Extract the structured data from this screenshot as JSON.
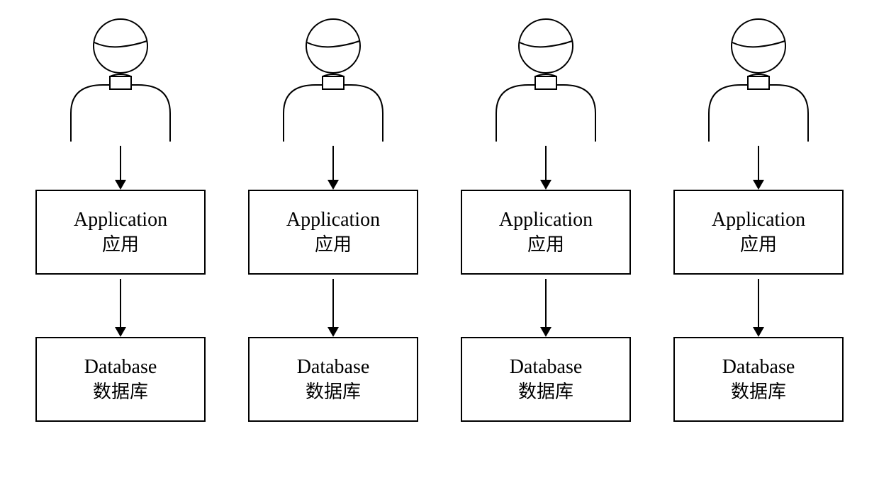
{
  "columns": [
    {
      "application": {
        "en": "Application",
        "cn": "应用"
      },
      "database": {
        "en": "Database",
        "cn": "数据库"
      }
    },
    {
      "application": {
        "en": "Application",
        "cn": "应用"
      },
      "database": {
        "en": "Database",
        "cn": "数据库"
      }
    },
    {
      "application": {
        "en": "Application",
        "cn": "应用"
      },
      "database": {
        "en": "Database",
        "cn": "数据库"
      }
    },
    {
      "application": {
        "en": "Application",
        "cn": "应用"
      },
      "database": {
        "en": "Database",
        "cn": "数据库"
      }
    }
  ]
}
